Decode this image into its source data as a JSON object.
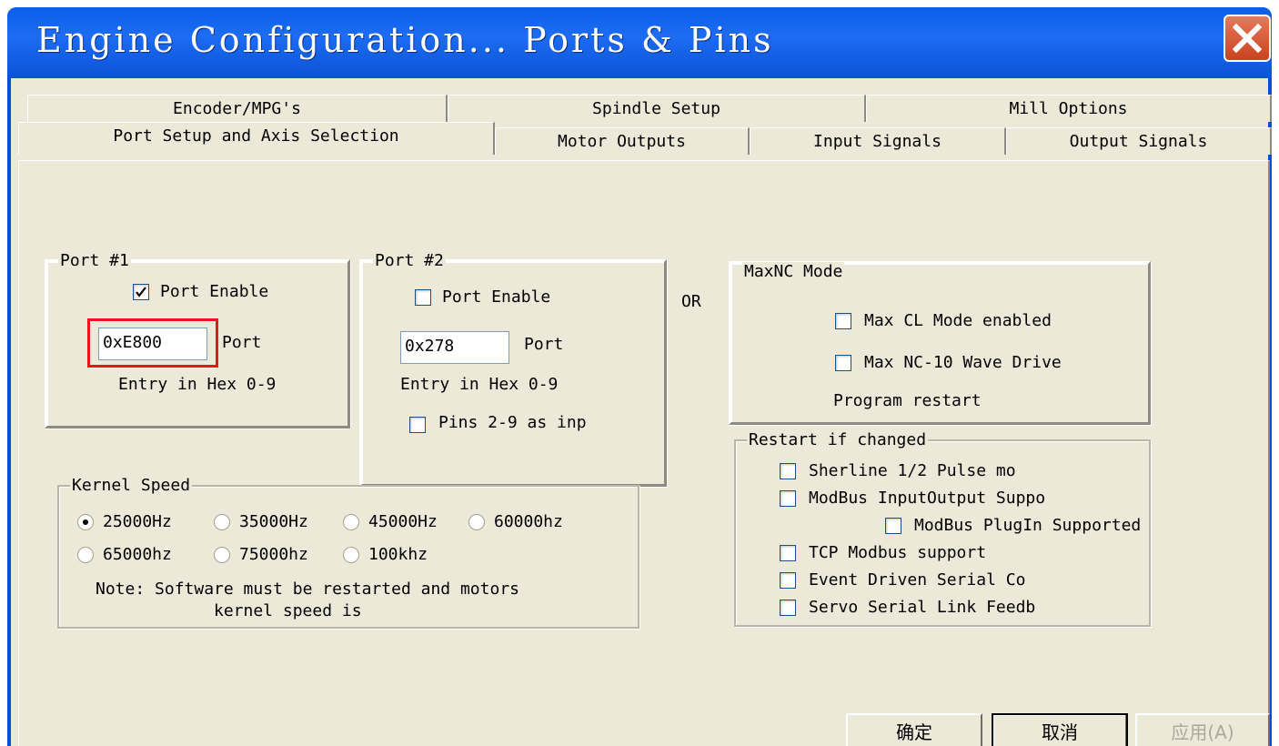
{
  "window": {
    "title": "Engine Configuration... Ports & Pins"
  },
  "tabs": {
    "row1": [
      "Encoder/MPG's",
      "Spindle Setup",
      "Mill Options"
    ],
    "row2": [
      "Port Setup and Axis Selection",
      "Motor Outputs",
      "Input Signals",
      "Output Signals"
    ],
    "active": "Port Setup and Axis Selection"
  },
  "port1": {
    "legend": "Port #1",
    "enable_label": "Port Enable",
    "enabled": true,
    "address": "0xE800",
    "port_label": "Port",
    "hint": "Entry in Hex 0-9"
  },
  "port2": {
    "legend": "Port #2",
    "enable_label": "Port Enable",
    "enabled": false,
    "address": "0x278",
    "port_label": "Port",
    "hint": "Entry in Hex 0-9",
    "pins_label": "Pins 2-9 as inp",
    "pins_checked": false
  },
  "or_label": "OR",
  "maxnc": {
    "legend": "MaxNC Mode",
    "cl_label": "Max CL Mode enabled",
    "nc10_label": "Max NC-10 Wave Drive",
    "note": "Program restart"
  },
  "restart": {
    "legend": "Restart if changed",
    "items": [
      "Sherline 1/2 Pulse mo",
      "ModBus InputOutput Suppo",
      "ModBus PlugIn Supported",
      "TCP Modbus support",
      "Event Driven Serial Co",
      "Servo Serial Link Feedb"
    ]
  },
  "kernel": {
    "legend": "Kernel Speed",
    "options": [
      "25000Hz",
      "35000Hz",
      "45000Hz",
      "60000hz",
      "65000hz",
      "75000hz",
      "100khz"
    ],
    "selected": "25000Hz",
    "note_line1": "Note: Software must be restarted and motors",
    "note_line2": "kernel speed is"
  },
  "buttons": {
    "ok": "确定",
    "cancel": "取消",
    "apply": "应用(A)"
  },
  "colors": {
    "titlebar": "#0a5ee8",
    "face": "#ece9d8",
    "highlight": "#e8161c",
    "close": "#d6532f"
  }
}
